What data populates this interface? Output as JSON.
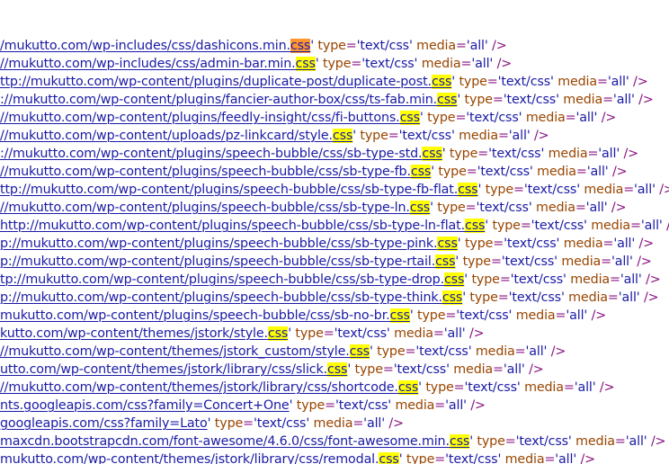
{
  "view": {
    "highlight_color": "#ffff00",
    "current_match_color": "#ff9632",
    "link_color": "#1a1aa6",
    "attr_color": "#994500",
    "tag_color": "#881280",
    "lines": [
      {
        "url": "/mukutto.com/wp-includes/css/dashicons.min.",
        "ext": "css",
        "rest": "' type='text/css' media='all' />",
        "current": true
      },
      {
        "url": "//mukutto.com/wp-includes/css/admin-bar.min.",
        "ext": "css",
        "rest": "' type='text/css' media='all' />",
        "current": false
      },
      {
        "url": "ttp://mukutto.com/wp-content/plugins/duplicate-post/duplicate-post.",
        "ext": "css",
        "rest": "' type='text/css' media='all' />",
        "current": false
      },
      {
        "url": "://mukutto.com/wp-content/plugins/fancier-author-box/css/ts-fab.min.",
        "ext": "css",
        "rest": "' type='text/css' media='all' />",
        "current": false
      },
      {
        "url": "//mukutto.com/wp-content/plugins/feedly-insight/css/fi-buttons.",
        "ext": "css",
        "rest": "' type='text/css' media='all' />",
        "current": false
      },
      {
        "url": "//mukutto.com/wp-content/uploads/pz-linkcard/style.",
        "ext": "css",
        "rest": "' type='text/css' media='all' />",
        "current": false
      },
      {
        "url": "://mukutto.com/wp-content/plugins/speech-bubble/css/sb-type-std.",
        "ext": "css",
        "rest": "' type='text/css' media='all' />",
        "current": false
      },
      {
        "url": "//mukutto.com/wp-content/plugins/speech-bubble/css/sb-type-fb.",
        "ext": "css",
        "rest": "' type='text/css' media='all' />",
        "current": false
      },
      {
        "url": "ttp://mukutto.com/wp-content/plugins/speech-bubble/css/sb-type-fb-flat.",
        "ext": "css",
        "rest": "' type='text/css' media='all' />",
        "current": false
      },
      {
        "url": "//mukutto.com/wp-content/plugins/speech-bubble/css/sb-type-ln.",
        "ext": "css",
        "rest": "' type='text/css' media='all' />",
        "current": false
      },
      {
        "url": "http://mukutto.com/wp-content/plugins/speech-bubble/css/sb-type-ln-flat.",
        "ext": "css",
        "rest": "' type='text/css' media='all' />",
        "current": false
      },
      {
        "url": "p://mukutto.com/wp-content/plugins/speech-bubble/css/sb-type-pink.",
        "ext": "css",
        "rest": "' type='text/css' media='all' />",
        "current": false
      },
      {
        "url": "p://mukutto.com/wp-content/plugins/speech-bubble/css/sb-type-rtail.",
        "ext": "css",
        "rest": "' type='text/css' media='all' />",
        "current": false
      },
      {
        "url": "tp://mukutto.com/wp-content/plugins/speech-bubble/css/sb-type-drop.",
        "ext": "css",
        "rest": "' type='text/css' media='all' />",
        "current": false
      },
      {
        "url": "p://mukutto.com/wp-content/plugins/speech-bubble/css/sb-type-think.",
        "ext": "css",
        "rest": "' type='text/css' media='all' />",
        "current": false
      },
      {
        "url": "mukutto.com/wp-content/plugins/speech-bubble/css/sb-no-br.",
        "ext": "css",
        "rest": "' type='text/css' media='all' />",
        "current": false
      },
      {
        "url": "kutto.com/wp-content/themes/jstork/style.",
        "ext": "css",
        "rest": "' type='text/css' media='all' />",
        "current": false
      },
      {
        "url": "//mukutto.com/wp-content/themes/jstork_custom/style.",
        "ext": "css",
        "rest": "' type='text/css' media='all' />",
        "current": false
      },
      {
        "url": "utto.com/wp-content/themes/jstork/library/css/slick.",
        "ext": "css",
        "rest": "' type='text/css' media='all' />",
        "current": false
      },
      {
        "url": "//mukutto.com/wp-content/themes/jstork/library/css/shortcode.",
        "ext": "css",
        "rest": "' type='text/css' media='all' />",
        "current": false
      },
      {
        "url": "nts.googleapis.com/css?family=Concert+One",
        "ext": "",
        "rest": "' type='text/css' media='all' />",
        "current": false
      },
      {
        "url": "googleapis.com/css?family=Lato",
        "ext": "",
        "rest": "' type='text/css' media='all' />",
        "current": false
      },
      {
        "url": "maxcdn.bootstrapcdn.com/font-awesome/4.6.0/css/font-awesome.min.",
        "ext": "css",
        "rest": "' type='text/css' media='all' />",
        "current": false
      },
      {
        "url": "mukutto.com/wp-content/themes/jstork/library/css/remodal.",
        "ext": "css",
        "rest": "' type='text/css' media='all' />",
        "current": false
      }
    ]
  }
}
